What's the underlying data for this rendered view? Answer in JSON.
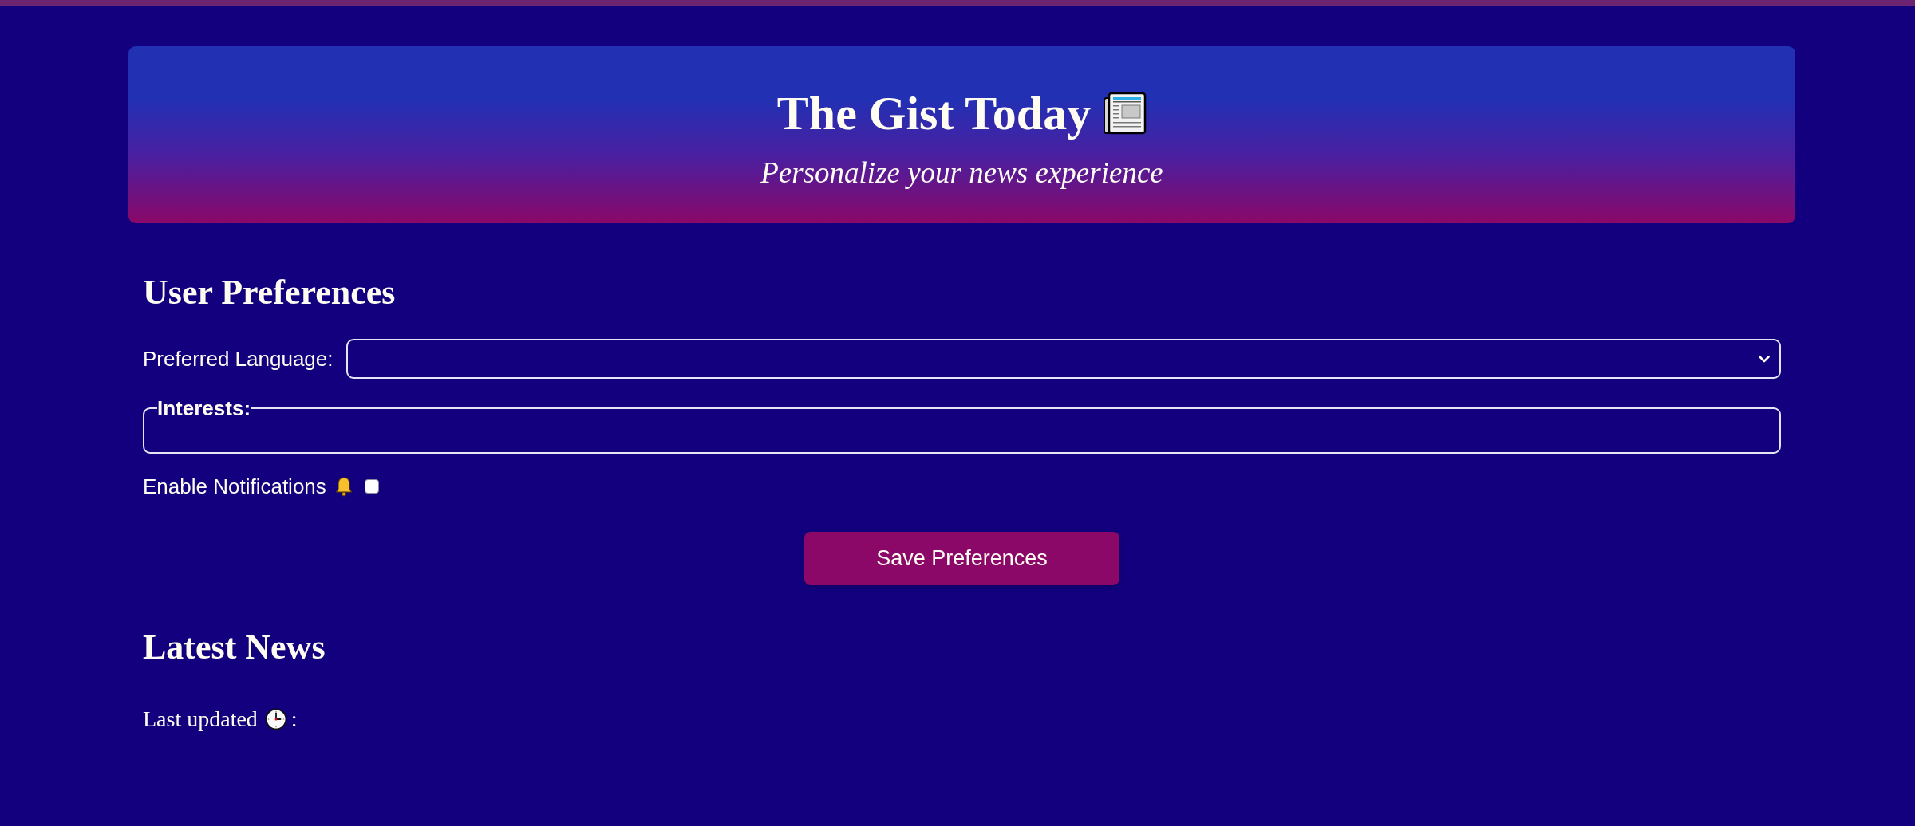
{
  "header": {
    "title": "The Gist Today",
    "subtitle": "Personalize your news experience"
  },
  "preferences": {
    "heading": "User Preferences",
    "language": {
      "label": "Preferred Language:"
    },
    "interests": {
      "legend": "Interests:"
    },
    "notifications": {
      "label": "Enable Notifications",
      "checked": false
    },
    "save_button": "Save Preferences"
  },
  "news": {
    "heading": "Latest News",
    "last_updated": {
      "label": "Last updated",
      "suffix": ":"
    }
  }
}
